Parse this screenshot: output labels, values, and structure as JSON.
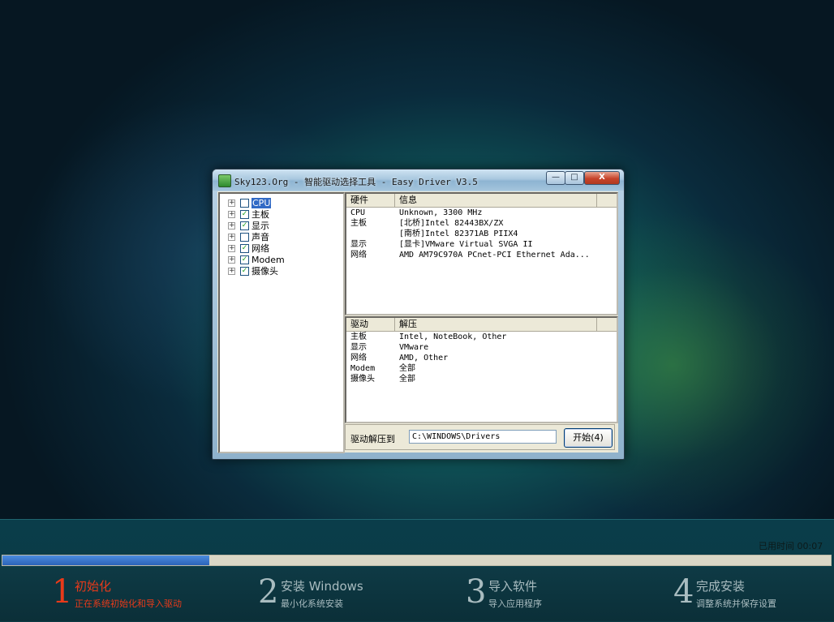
{
  "window": {
    "title": "Sky123.Org - 智能驱动选择工具 - Easy Driver V3.5",
    "min_glyph": "—",
    "max_glyph": "□",
    "close_glyph": "X"
  },
  "tree": {
    "items": [
      {
        "label": "CPU",
        "checked": false,
        "selected": true
      },
      {
        "label": "主板",
        "checked": true
      },
      {
        "label": "显示",
        "checked": true
      },
      {
        "label": "声音",
        "checked": false
      },
      {
        "label": "网络",
        "checked": true
      },
      {
        "label": "Modem",
        "checked": true
      },
      {
        "label": "摄像头",
        "checked": true
      }
    ]
  },
  "hardware_list": {
    "columns": [
      "硬件",
      "信息"
    ],
    "rows": [
      [
        "CPU",
        "Unknown, 3300 MHz"
      ],
      [
        "主板",
        "[北桥]Intel 82443BX/ZX"
      ],
      [
        "",
        "[南桥]Intel 82371AB PIIX4"
      ],
      [
        "显示",
        "[显卡]VMware Virtual SVGA II"
      ],
      [
        "网络",
        "AMD AM79C970A PCnet-PCI Ethernet Ada..."
      ]
    ]
  },
  "driver_list": {
    "columns": [
      "驱动",
      "解压"
    ],
    "rows": [
      [
        "主板",
        "Intel, NoteBook, Other"
      ],
      [
        "显示",
        "VMware"
      ],
      [
        "网络",
        "AMD, Other"
      ],
      [
        "Modem",
        "全部"
      ],
      [
        "摄像头",
        "全部"
      ]
    ]
  },
  "extract": {
    "label": "驱动解压到",
    "path": "C:\\WINDOWS\\Drivers",
    "start_button": "开始(4)"
  },
  "setup": {
    "elapsed_label": "已用时间 00:07",
    "progress": 0.25,
    "steps": [
      {
        "num": "1",
        "title": "初始化",
        "sub": "正在系统初始化和导入驱动",
        "active": true
      },
      {
        "num": "2",
        "title": "安装 Windows",
        "sub": "最小化系统安装",
        "active": false
      },
      {
        "num": "3",
        "title": "导入软件",
        "sub": "导入应用程序",
        "active": false
      },
      {
        "num": "4",
        "title": "完成安装",
        "sub": "调整系统并保存设置",
        "active": false
      }
    ]
  }
}
